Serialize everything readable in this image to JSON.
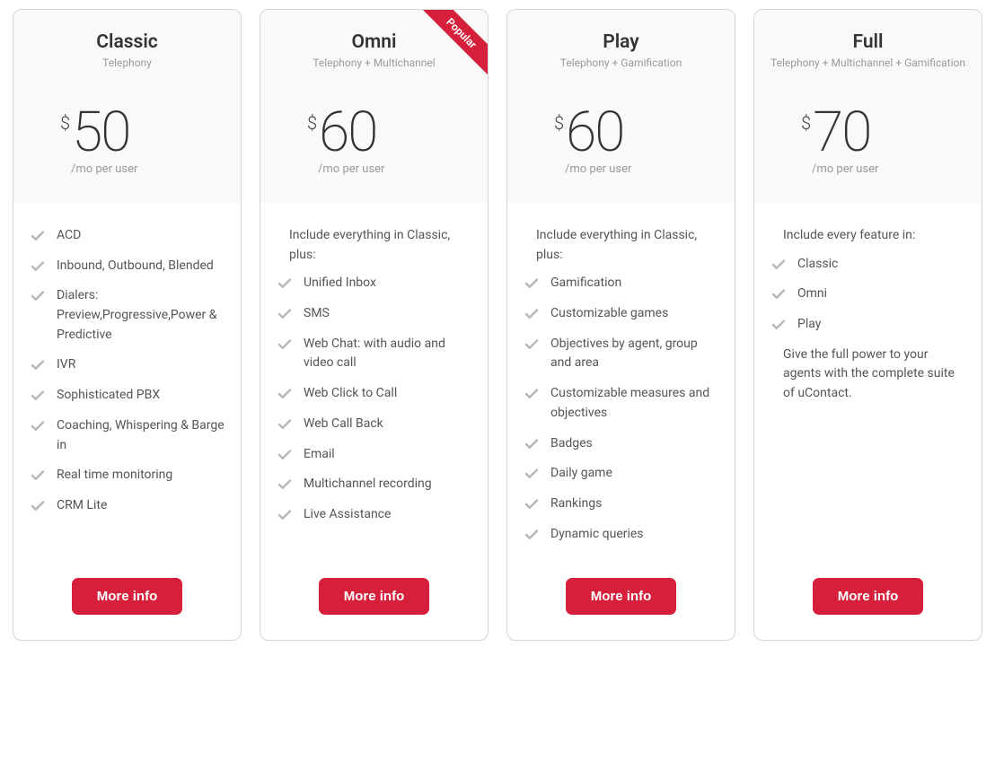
{
  "currency": "$",
  "per_text": "/mo per user",
  "button_label": "More info",
  "popular_label": "Popular",
  "plans": [
    {
      "name": "Classic",
      "subtitle": "Telephony",
      "price": "50",
      "popular": false,
      "intro": "",
      "features": [
        "ACD",
        "Inbound, Outbound, Blended",
        "Dialers: Preview,Progressive,Power & Predictive",
        "IVR",
        "Sophisticated PBX",
        "Coaching, Whispering & Barge in",
        "Real time monitoring",
        "CRM Lite"
      ],
      "outro": ""
    },
    {
      "name": "Omni",
      "subtitle": "Telephony + Multichannel",
      "price": "60",
      "popular": true,
      "intro": "Include everything in Classic, plus:",
      "features": [
        "Unified Inbox",
        "SMS",
        "Web Chat: with audio and video call",
        "Web Click to Call",
        "Web Call Back",
        "Email",
        "Multichannel recording",
        "Live Assistance"
      ],
      "outro": ""
    },
    {
      "name": "Play",
      "subtitle": "Telephony + Gamification",
      "price": "60",
      "popular": false,
      "intro": "Include everything in Classic, plus:",
      "features": [
        "Gamification",
        "Customizable games",
        "Objectives by agent, group and area",
        "Customizable measures and objectives",
        "Badges",
        "Daily game",
        "Rankings",
        "Dynamic queries"
      ],
      "outro": ""
    },
    {
      "name": "Full",
      "subtitle": "Telephony + Multichannel + Gamification",
      "price": "70",
      "popular": false,
      "intro": "Include every feature in:",
      "features": [
        "Classic",
        "Omni",
        "Play"
      ],
      "outro": "Give the full power to your agents with the complete suite of uContact."
    }
  ]
}
